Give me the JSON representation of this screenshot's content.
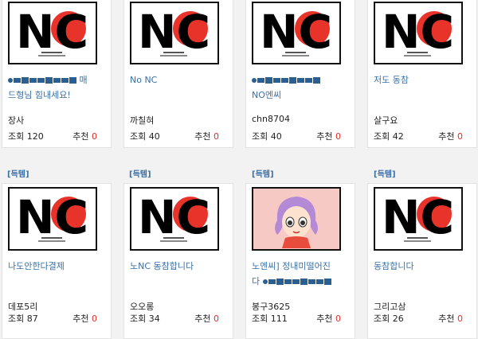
{
  "colors": {
    "link": "#3a6fa6",
    "recommend_zero": "#e03030",
    "sun": "#e8332a"
  },
  "thumbnail_icons": {
    "nc": "no-nc-logo-icon",
    "anime": "anime-girl-icon"
  },
  "nc_logo": {
    "letters": "NC"
  },
  "tag_label": "[득템]",
  "views_label": "조회",
  "recommend_label": "추천",
  "posts": [
    {
      "title": "드형님 힘내세요!",
      "title_prefix_masked": true,
      "title_suffix": "매",
      "author": "장사",
      "views": "120",
      "recommend": "0"
    },
    {
      "title": "No NC",
      "title_prefix_masked": false,
      "author": "까칠혀",
      "views": "40",
      "recommend": "0"
    },
    {
      "title": "NO엔씨",
      "title_prefix_masked": true,
      "author": "chn8704",
      "views": "40",
      "recommend": "0"
    },
    {
      "title": "저도 동참",
      "title_prefix_masked": false,
      "author": "살구요",
      "views": "42",
      "recommend": "0"
    },
    {
      "title": "나도안한다결제",
      "title_prefix_masked": false,
      "author": "데포5리",
      "views": "87",
      "recommend": "0"
    },
    {
      "title": "노NC 동참합니다",
      "title_prefix_masked": false,
      "author": "오오롱",
      "views": "34",
      "recommend": "0"
    },
    {
      "title": "노엔씨] 정내미떨어진",
      "title_line2_prefix": "다",
      "title_prefix_masked": false,
      "author": "봉구3625",
      "views": "111",
      "recommend": "0"
    },
    {
      "title": "동참합니다",
      "title_prefix_masked": false,
      "author": "그리고삼",
      "views": "26",
      "recommend": "0"
    }
  ]
}
